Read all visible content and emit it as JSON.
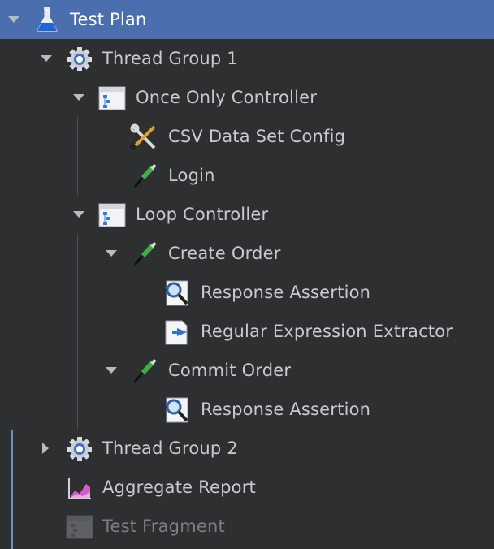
{
  "tree": {
    "nodes": [
      {
        "label": "Test Plan",
        "icon": "flask-icon",
        "expanded": true,
        "selected": true
      },
      {
        "label": "Thread Group 1",
        "icon": "gear-icon",
        "expanded": true
      },
      {
        "label": "Once Only Controller",
        "icon": "controller-icon",
        "expanded": true
      },
      {
        "label": "CSV Data Set Config",
        "icon": "config-tools-icon"
      },
      {
        "label": "Login",
        "icon": "pipette-icon"
      },
      {
        "label": "Loop Controller",
        "icon": "controller-icon",
        "expanded": true
      },
      {
        "label": "Create Order",
        "icon": "pipette-icon",
        "expanded": true
      },
      {
        "label": "Response Assertion",
        "icon": "magnifier-icon"
      },
      {
        "label": "Regular Expression Extractor",
        "icon": "extractor-icon"
      },
      {
        "label": "Commit Order",
        "icon": "pipette-icon",
        "expanded": true
      },
      {
        "label": "Response Assertion",
        "icon": "magnifier-icon"
      },
      {
        "label": "Thread Group 2",
        "icon": "gear-icon",
        "expanded": false
      },
      {
        "label": "Aggregate Report",
        "icon": "chart-report-icon"
      },
      {
        "label": "Test Fragment",
        "icon": "controller-icon",
        "disabled": true
      }
    ]
  },
  "colors": {
    "background": "#2d2f31",
    "selection": "#4b6eaf",
    "text": "#c8cbce",
    "disabled_text": "#7c7f82"
  }
}
